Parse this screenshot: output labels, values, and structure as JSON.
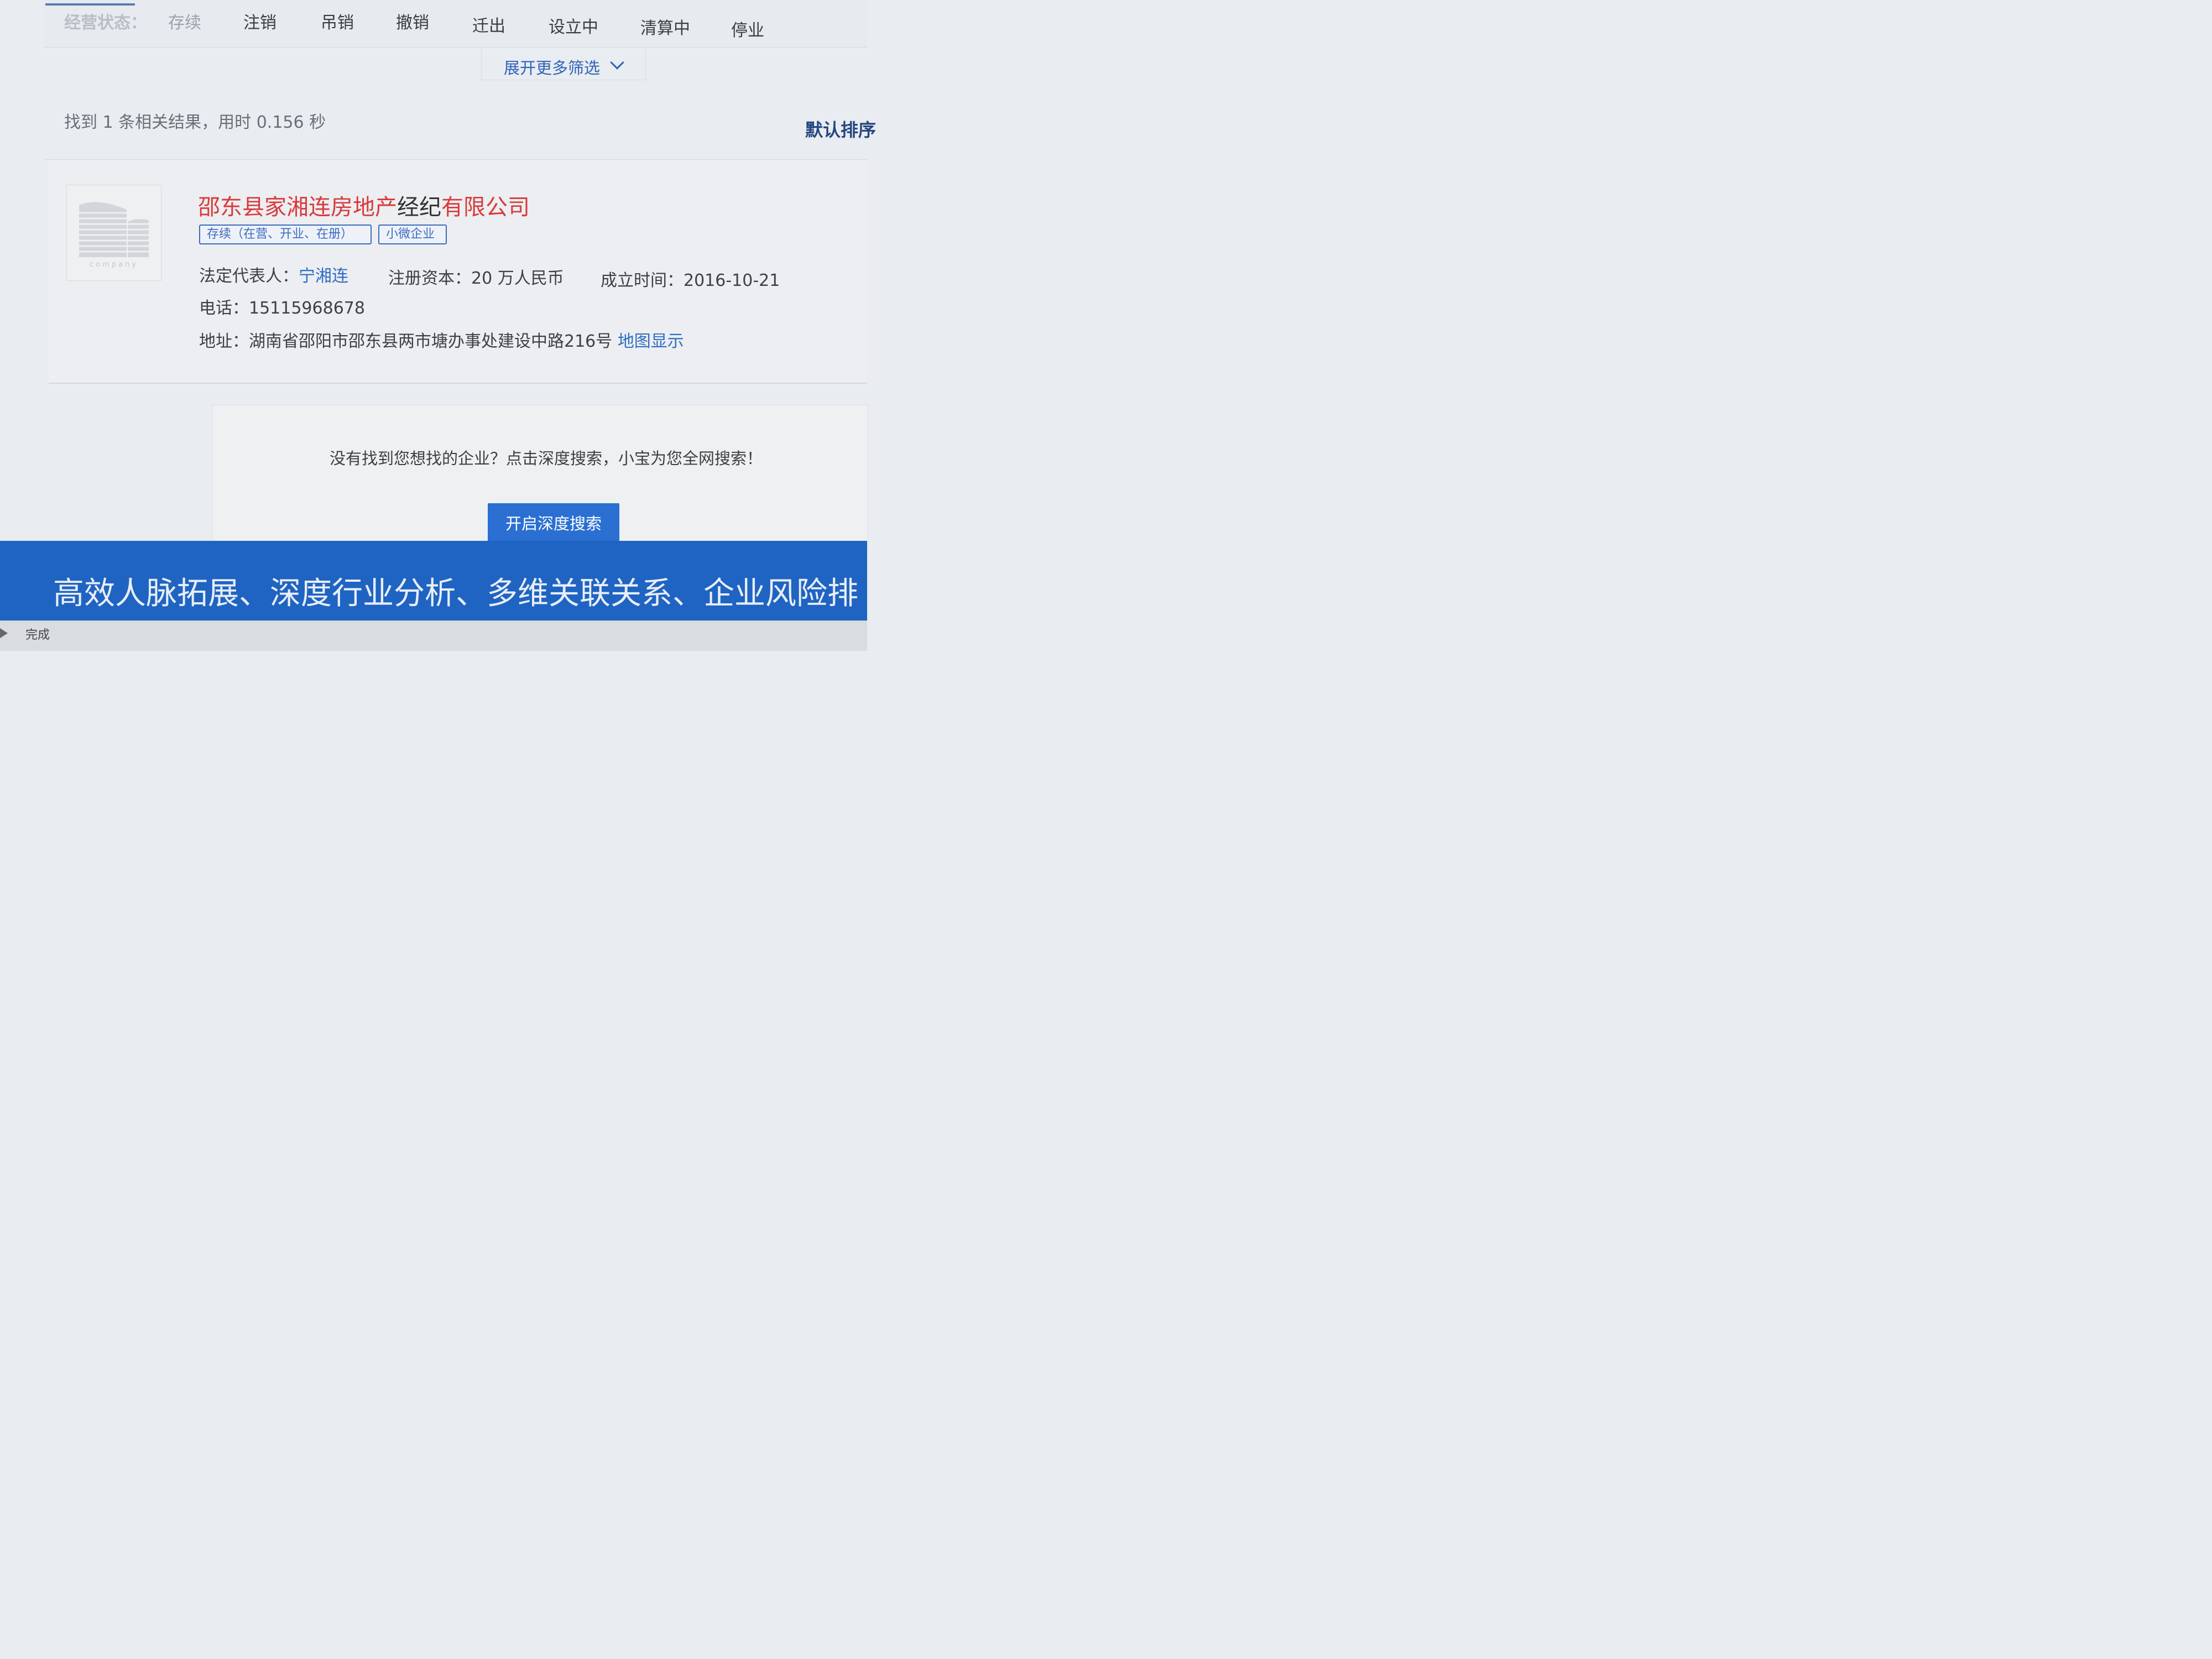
{
  "filter": {
    "label": "经营状态：",
    "options": [
      "存续",
      "注销",
      "吊销",
      "撤销",
      "迁出",
      "设立中",
      "清算中",
      "停业"
    ],
    "expand_label": "展开更多筛选"
  },
  "results": {
    "count_text": "找到 1 条相关结果，用时 0.156 秒",
    "sort_label": "默认排序"
  },
  "company": {
    "logo_caption": "company",
    "name_part1": "邵东县家湘连房地产",
    "name_part2": "经纪",
    "name_part3": "有限公司",
    "tags": [
      "存续（在营、开业、在册）",
      "小微企业"
    ],
    "legal_rep_label": "法定代表人：",
    "legal_rep": "宁湘连",
    "capital_label": "注册资本：",
    "capital": "20 万人民币",
    "founded_label": "成立时间：",
    "founded": "2016-10-21",
    "phone_label": "电话：",
    "phone": "15115968678",
    "address_label": "地址：",
    "address": "湖南省邵阳市邵东县两市塘办事处建设中路216号",
    "map_link": "地图显示"
  },
  "deep_search": {
    "prompt": "没有找到您想找的企业？点击深度搜索，小宝为您全网搜索！",
    "button": "开启深度搜索"
  },
  "promo": {
    "text": "高效人脉拓展、深度行业分析、多维关联关系、企业风险排"
  },
  "status_bar": {
    "text": "完成"
  }
}
